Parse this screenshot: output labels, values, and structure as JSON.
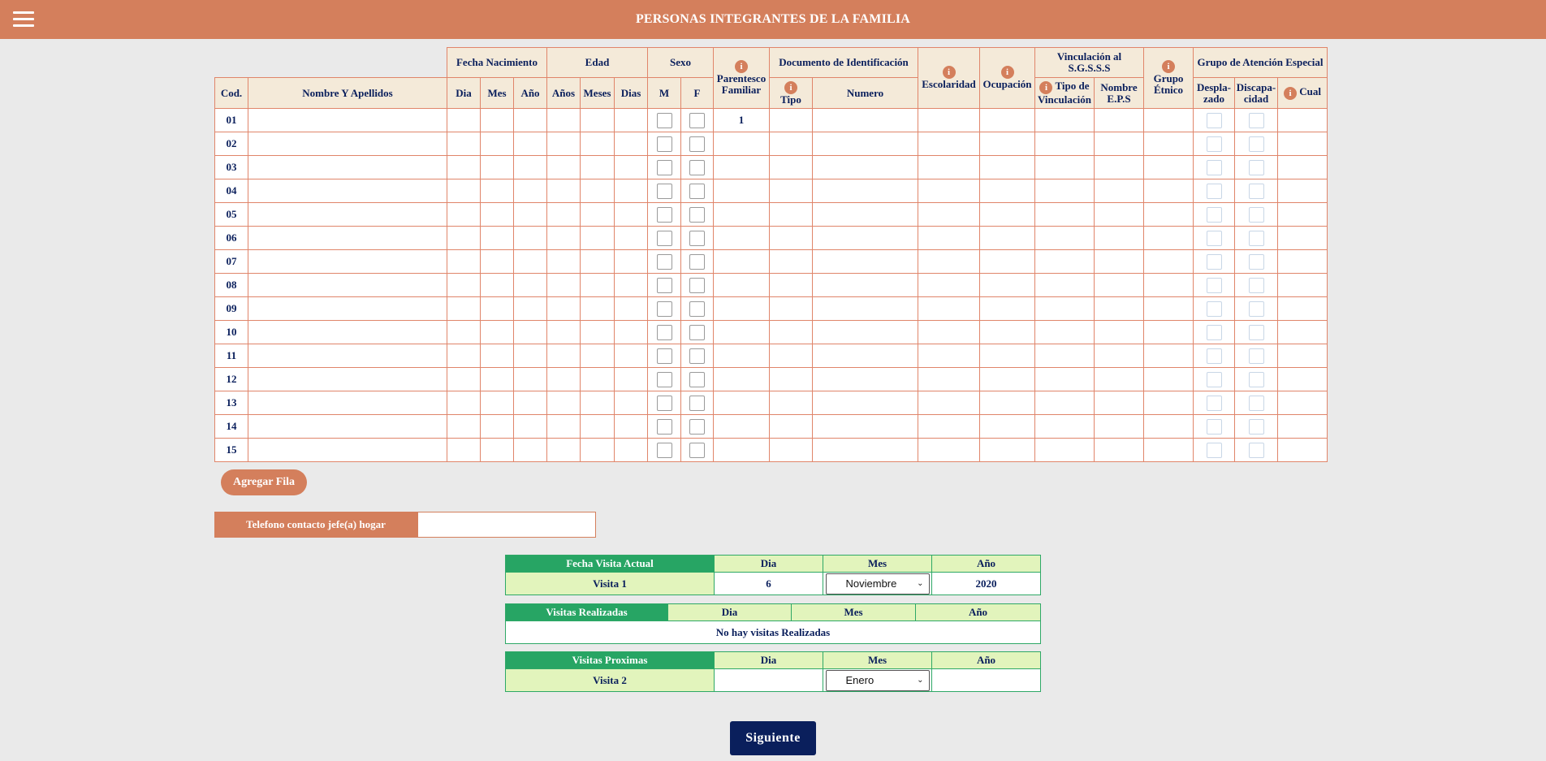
{
  "header": {
    "title": "PERSONAS INTEGRANTES DE LA FAMILIA"
  },
  "table": {
    "group_headers": {
      "fecha_nacimiento": "Fecha Nacimiento",
      "edad": "Edad",
      "sexo": "Sexo",
      "parentesco": "Parentesco Familiar",
      "documento": "Documento de Identificación",
      "escolaridad": "Escolaridad",
      "ocupacion": "Ocupación",
      "vinculacion": "Vinculación al S.G.S.S.S",
      "grupo_etnico": "Grupo Étnico",
      "grupo_atencion": "Grupo de Atención Especial"
    },
    "columns": {
      "cod": "Cod.",
      "nombre": "Nombre Y Apellidos",
      "dia": "Dia",
      "mes": "Mes",
      "anio": "Año",
      "anios": "Años",
      "meses": "Meses",
      "dias": "Dias",
      "m": "M",
      "f": "F",
      "tipo": "Tipo",
      "numero": "Numero",
      "tipo_vinculacion": "Tipo de Vinculación",
      "nombre_eps": "Nombre E.P.S",
      "desplazado": "Despla-zado",
      "discapacidad": "Discapa-cidad",
      "cual": "Cual"
    },
    "info_icon": "i",
    "rows": [
      {
        "cod": "01",
        "parentesco": "1"
      },
      {
        "cod": "02",
        "parentesco": ""
      },
      {
        "cod": "03",
        "parentesco": ""
      },
      {
        "cod": "04",
        "parentesco": ""
      },
      {
        "cod": "05",
        "parentesco": ""
      },
      {
        "cod": "06",
        "parentesco": ""
      },
      {
        "cod": "07",
        "parentesco": ""
      },
      {
        "cod": "08",
        "parentesco": ""
      },
      {
        "cod": "09",
        "parentesco": ""
      },
      {
        "cod": "10",
        "parentesco": ""
      },
      {
        "cod": "11",
        "parentesco": ""
      },
      {
        "cod": "12",
        "parentesco": ""
      },
      {
        "cod": "13",
        "parentesco": ""
      },
      {
        "cod": "14",
        "parentesco": ""
      },
      {
        "cod": "15",
        "parentesco": ""
      }
    ]
  },
  "agregar_fila": "Agregar Fila",
  "telefono": {
    "label": "Telefono contacto jefe(a) hogar",
    "value": ""
  },
  "visita_actual": {
    "header": "Fecha Visita Actual",
    "dia_label": "Dia",
    "mes_label": "Mes",
    "anio_label": "Año",
    "row_label": "Visita 1",
    "dia": "6",
    "mes": "Noviembre",
    "anio": "2020"
  },
  "visitas_realizadas": {
    "header": "Visitas Realizadas",
    "dia_label": "Dia",
    "mes_label": "Mes",
    "anio_label": "Año",
    "empty": "No hay visitas Realizadas"
  },
  "visitas_proximas": {
    "header": "Visitas Proximas",
    "dia_label": "Dia",
    "mes_label": "Mes",
    "anio_label": "Año",
    "row_label": "Visita 2",
    "dia": "",
    "mes": "Enero",
    "anio": ""
  },
  "siguiente": "Siguiente",
  "colors": {
    "accent": "#d47f5c",
    "green": "#27a564",
    "navy": "#0a1f5c"
  }
}
